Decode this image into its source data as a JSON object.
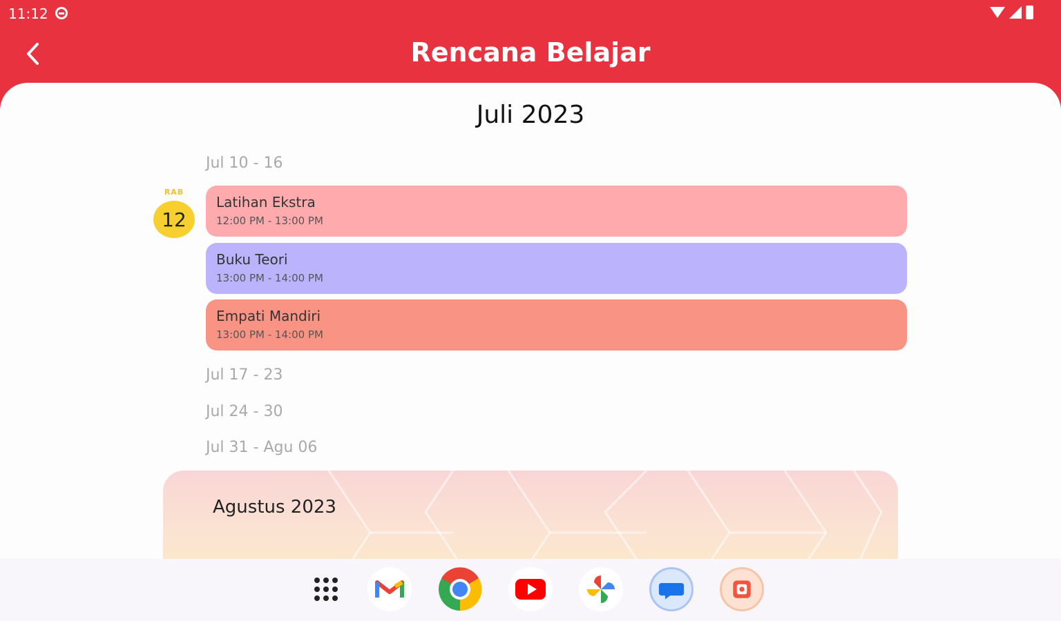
{
  "status_bar": {
    "time": "11:12"
  },
  "app_bar": {
    "title": "Rencana Belajar"
  },
  "calendar": {
    "month_title": "Juli 2023",
    "weeks": [
      "Jul 10 - 16",
      "Jul 17 - 23",
      "Jul 24 - 30",
      "Jul 31 - Agu 06"
    ],
    "selected_day": {
      "abbr": "RAB",
      "number": "12"
    },
    "events": [
      {
        "title": "Latihan Ekstra",
        "time": "12:00 PM - 13:00 PM",
        "color": "#ffabad"
      },
      {
        "title": "Buku Teori",
        "time": "13:00 PM - 14:00 PM",
        "color": "#bbb3fb"
      },
      {
        "title": "Empati Mandiri",
        "time": "13:00 PM - 14:00 PM",
        "color": "#f99384"
      }
    ],
    "next_month_label": "Agustus 2023"
  },
  "dock": {
    "apps": [
      "app-drawer-icon",
      "gmail-icon",
      "chrome-icon",
      "youtube-icon",
      "photos-icon",
      "messages-icon",
      "app-icon"
    ]
  },
  "colors": {
    "brand": "#e8323f",
    "day_highlight": "#f7d02f"
  }
}
